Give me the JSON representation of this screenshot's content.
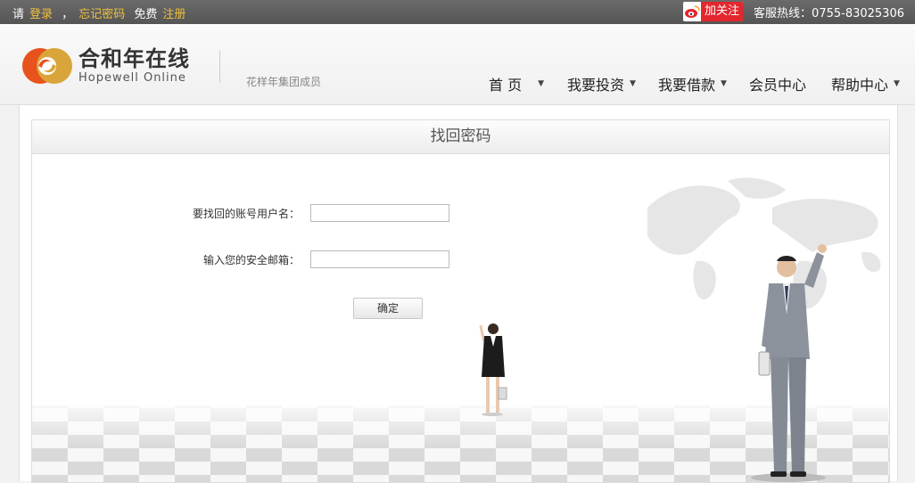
{
  "topbar": {
    "please": "请",
    "login": "登录",
    "comma": "，",
    "forgot": "忘记密码",
    "free": "免费",
    "register": "注册",
    "follow": "加关注",
    "hotline": "客服热线：0755-83025306"
  },
  "brand": {
    "name_cn": "合和年在线",
    "name_en": "Hopewell Online",
    "member": "花样年集团成员"
  },
  "nav": [
    {
      "label": "首 页"
    },
    {
      "label": "我要投资"
    },
    {
      "label": "我要借款"
    },
    {
      "label": "会员中心"
    },
    {
      "label": "帮助中心"
    }
  ],
  "panel": {
    "title": "找回密码",
    "username_label": "要找回的账号用户名：",
    "email_label": "输入您的安全邮箱：",
    "confirm": "确定"
  },
  "colors": {
    "topbar_link": "#f0c040",
    "weibo_red": "#e4262e",
    "logo_orange": "#e8521c",
    "logo_gold": "#d9a53a"
  }
}
